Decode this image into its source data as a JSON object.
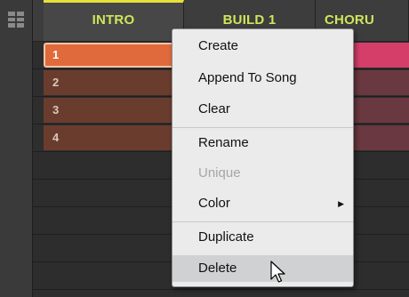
{
  "header": {
    "sections": [
      {
        "label": "INTRO"
      },
      {
        "label": "BUILD 1"
      },
      {
        "label": "CHORU"
      }
    ]
  },
  "patterns": [
    {
      "label": "1"
    },
    {
      "label": "2"
    },
    {
      "label": "3"
    },
    {
      "label": "4"
    }
  ],
  "context_menu": {
    "items": [
      {
        "label": "Create"
      },
      {
        "label": "Append To Song"
      },
      {
        "label": "Clear"
      },
      {
        "label": "Rename"
      },
      {
        "label": "Unique"
      },
      {
        "label": "Color"
      },
      {
        "label": "Duplicate"
      },
      {
        "label": "Delete"
      }
    ]
  },
  "colors": {
    "section_label": "#cfe55a",
    "active_marker": "#e8e03a",
    "selected_pattern": "#e06a3c",
    "pattern": "#6a3c2e",
    "chorus_selected": "#d63e6a",
    "chorus_pattern": "#6a3840"
  }
}
